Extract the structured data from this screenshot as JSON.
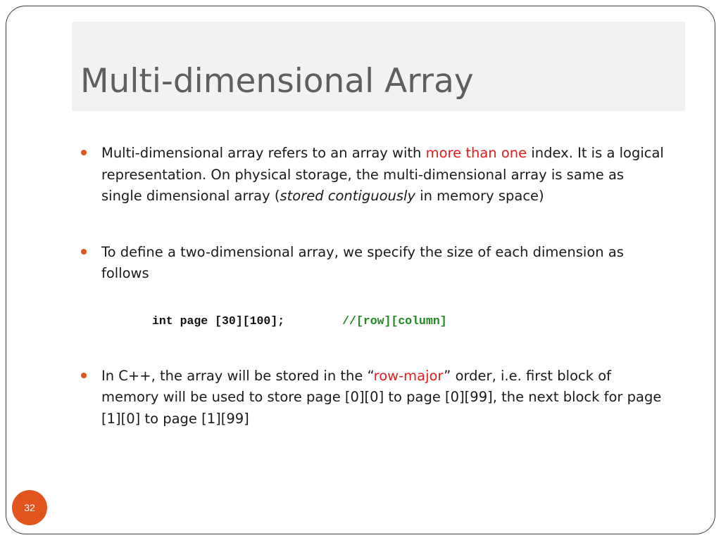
{
  "slide": {
    "title": "Multi-dimensional Array",
    "page_number": "32",
    "colors": {
      "accent": "#e2541d",
      "highlight": "#e31b1b",
      "code_comment": "#1f8a1f",
      "title_text": "#5f5f5f",
      "title_band": "#f2f2f2"
    }
  },
  "bullets": [
    {
      "text_before": "Multi-dimensional array refers to an array with ",
      "highlight": "more than one",
      "text_middle": " index.  It is a logical representation.  On physical storage, the multi-dimensional array is same as single dimensional array (",
      "italic": "stored contiguously",
      "text_after": " in memory space)"
    },
    {
      "text": "To define a two-dimensional array, we specify the size of each dimension as follows"
    },
    {
      "text_before": "In C++, the array will be stored in the “",
      "highlight": "row-major",
      "text_after": "” order, i.e. first block of memory will be used to store page [0][0] to page [0][99], the next block for page [1][0] to page [1][99]"
    }
  ],
  "code": {
    "statement": "int page [30][100];",
    "comment": "//[row][column]"
  }
}
